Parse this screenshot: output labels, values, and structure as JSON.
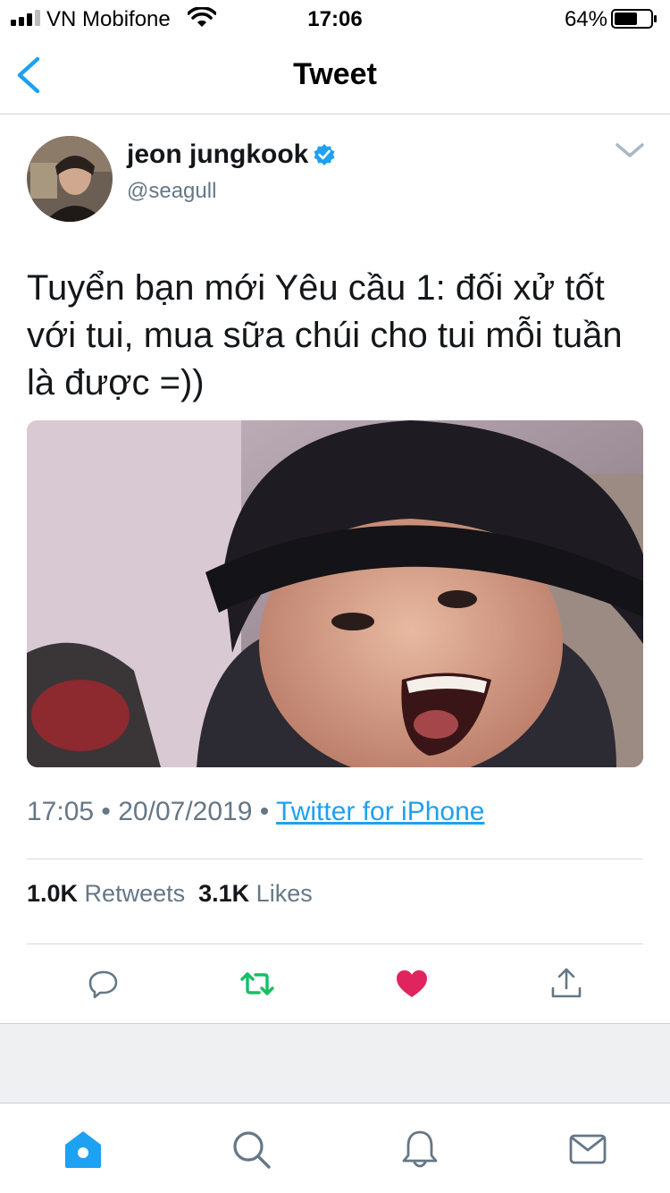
{
  "status_bar": {
    "carrier": "VN Mobifone",
    "time": "17:06",
    "battery_percent": "64%",
    "battery_level": 0.64,
    "signal_icon": "signal-bars-icon",
    "wifi_icon": "wifi-icon"
  },
  "nav": {
    "title": "Tweet",
    "back_icon": "chevron-left-icon"
  },
  "tweet": {
    "display_name": "jeon jungkook",
    "verified": true,
    "handle": "@seagull",
    "text": "Tuyển bạn mới Yêu cầu 1: đối xử tốt với tui, mua sữa chúi cho tui mỗi tuần là được =))",
    "timestamp": "17:05 • 20/07/2019 • ",
    "source": "Twitter for iPhone",
    "retweets_count": "1.0K",
    "retweets_label": " Retweets",
    "likes_count": "3.1K",
    "likes_label": " Likes"
  },
  "actions": [
    "reply-icon",
    "retweet-icon",
    "like-icon",
    "share-icon"
  ],
  "tab_bar": [
    "home-icon",
    "search-icon",
    "notifications-icon",
    "messages-icon"
  ],
  "colors": {
    "accent": "#1da1f2",
    "retweet": "#17bf63",
    "like": "#e0245e",
    "secondary_text": "#657786"
  }
}
